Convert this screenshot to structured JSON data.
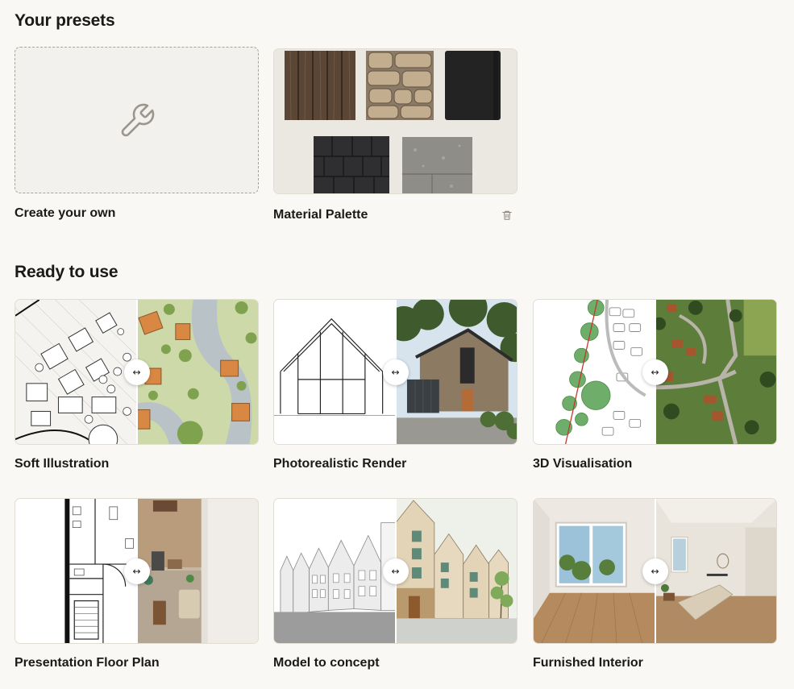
{
  "presets": {
    "title": "Your presets",
    "create_label": "Create your own",
    "items": [
      {
        "label": "Material Palette"
      }
    ]
  },
  "ready": {
    "title": "Ready to use",
    "items": [
      {
        "label": "Soft Illustration"
      },
      {
        "label": "Photorealistic Render"
      },
      {
        "label": "3D Visualisation"
      },
      {
        "label": "Presentation Floor Plan"
      },
      {
        "label": "Model to concept"
      },
      {
        "label": "Furnished Interior"
      }
    ]
  },
  "compare_glyph": "↔",
  "icons": {
    "create": "wrench-icon",
    "delete": "trash-icon",
    "compare": "compare-arrows-icon"
  }
}
